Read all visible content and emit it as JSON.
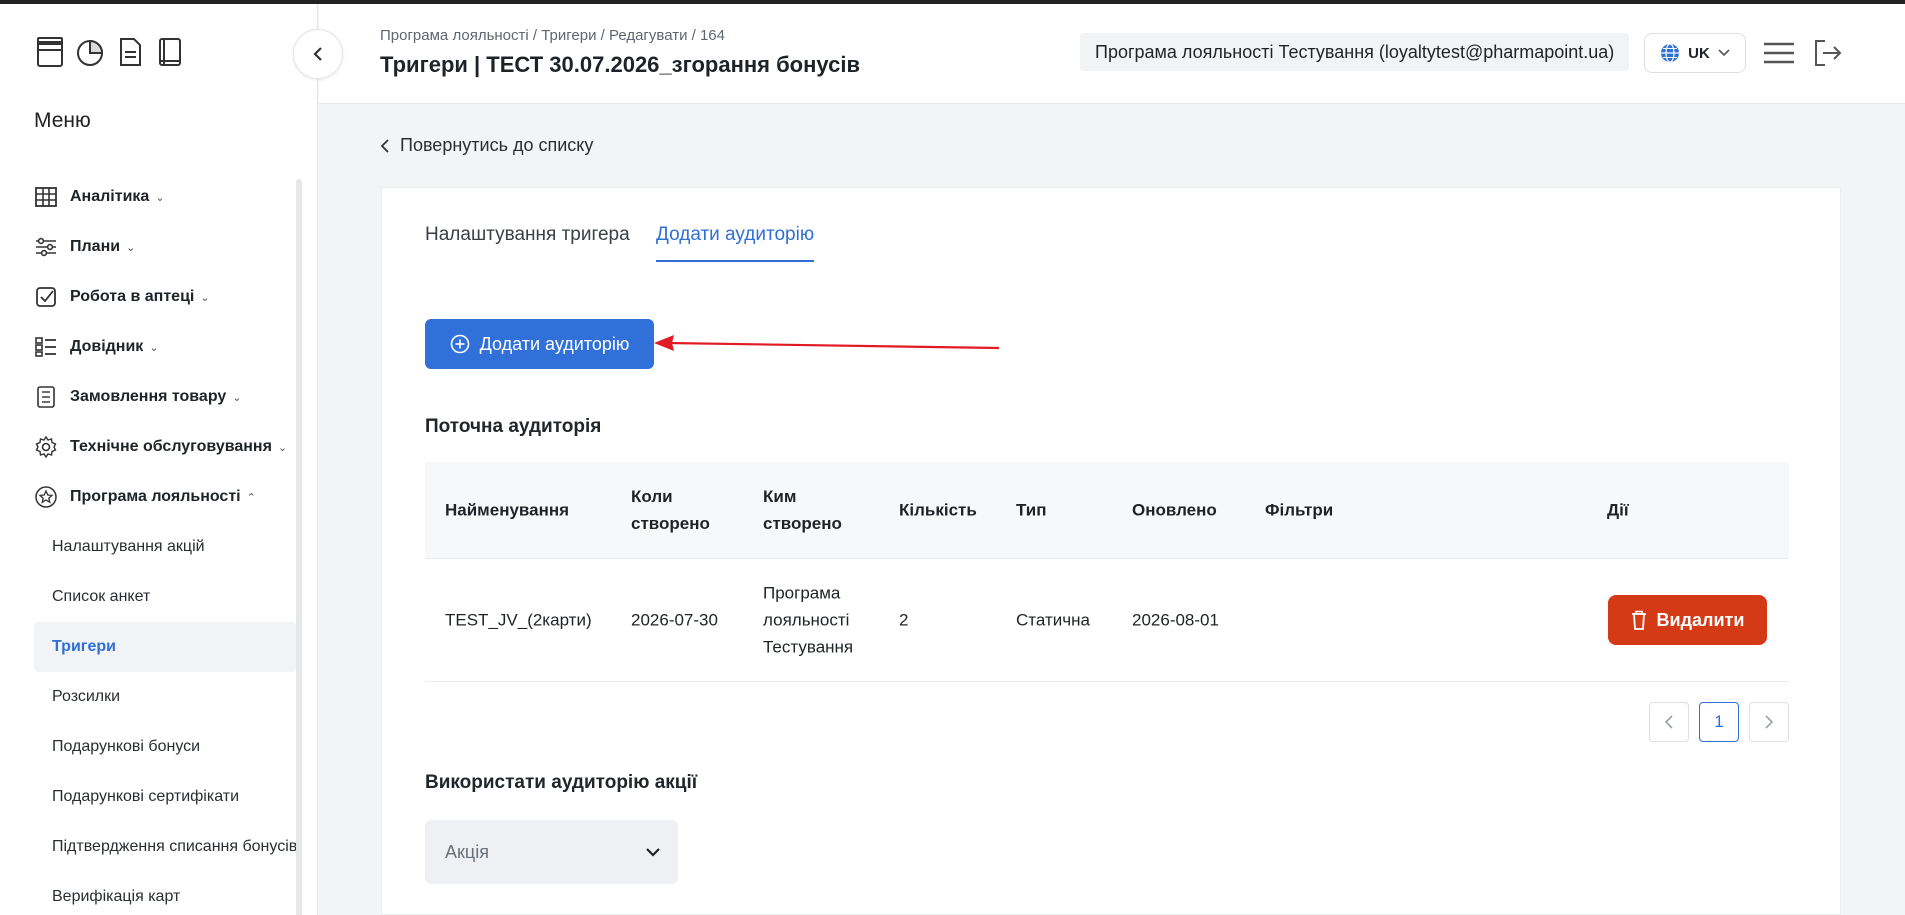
{
  "sidebar": {
    "menu_title": "Меню",
    "items": [
      {
        "label": "Аналітика"
      },
      {
        "label": "Плани"
      },
      {
        "label": "Робота в аптеці"
      },
      {
        "label": "Довідник"
      },
      {
        "label": "Замовлення товару"
      },
      {
        "label": "Технічне обслуговування"
      },
      {
        "label": "Програма лояльності"
      }
    ],
    "sub_items": [
      {
        "label": "Налаштування акцій"
      },
      {
        "label": "Список анкет"
      },
      {
        "label": "Тригери"
      },
      {
        "label": "Розсилки"
      },
      {
        "label": "Подарункові бонуси"
      },
      {
        "label": "Подарункові сертифікати"
      },
      {
        "label": "Підтвердження списання бонусів"
      },
      {
        "label": "Верифікація карт"
      }
    ]
  },
  "header": {
    "breadcrumb": "Програма лояльності / Тригери / Редагувати / 164",
    "title": "Тригери | ТЕСТ 30.07.2026_згорання бонусів",
    "account": "Програма лояльності Тестування (loyaltytest@pharmapoint.ua)",
    "language": "UK"
  },
  "main": {
    "back_label": "Повернутись до списку",
    "tabs": [
      {
        "label": "Налаштування тригера"
      },
      {
        "label": "Додати аудиторію"
      }
    ],
    "add_audience_label": "Додати аудиторію",
    "current_audience_title": "Поточна аудиторія",
    "table": {
      "headers": [
        "Найменування",
        "Коли створено",
        "Ким створено",
        "Кількість",
        "Тип",
        "Оновлено",
        "Фільтри",
        "Дії"
      ],
      "rows": [
        {
          "name": "TEST_JV_(2карти)",
          "created_at": "2026-07-30",
          "created_by": "Програма лояльності Тестування",
          "count": "2",
          "type": "Статична",
          "updated": "2026-08-01",
          "filters": "",
          "delete_label": "Видалити"
        }
      ]
    },
    "pagination": {
      "current": "1"
    },
    "use_promo_title": "Використати аудиторію акції",
    "promo_select_placeholder": "Акція"
  },
  "colors": {
    "accent": "#3070d8",
    "danger": "#d53a17",
    "annotation_arrow": "#e01b24"
  }
}
